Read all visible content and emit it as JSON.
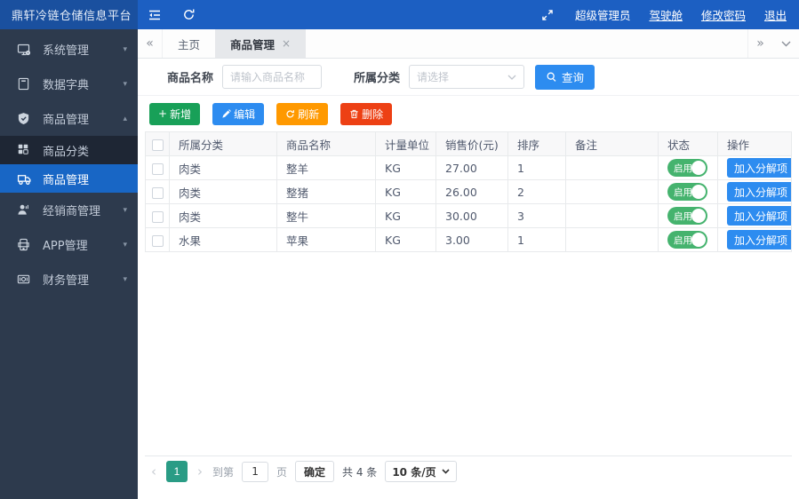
{
  "colors": {
    "topbar_blue": "#1c5fc2",
    "brand_blue": "#1a509f",
    "sidebar_bg": "#2d3a4d",
    "submenu_bg": "#1e2634",
    "active_menu_blue": "#1866c5",
    "primary_blue": "#2d8cf0",
    "success_green": "#18a058",
    "warning_orange": "#ff9900",
    "danger_red": "#ed4014",
    "switch_green": "#45b36e",
    "page_active_teal": "#2a9c85"
  },
  "glyphs": {
    "caret_down": "▾",
    "caret_up": "▴",
    "scroll_left": "«",
    "scroll_right": "»",
    "prev": "‹",
    "next": "›",
    "close": "×",
    "plus": "+"
  },
  "topbar": {
    "brand": "鼎轩冷链仓储信息平台",
    "user": "超级管理员",
    "links": [
      {
        "label": "驾驶舱"
      },
      {
        "label": "修改密码"
      },
      {
        "label": "退出"
      }
    ]
  },
  "sidebar": {
    "items": [
      {
        "label": "系统管理"
      },
      {
        "label": "数据字典"
      },
      {
        "label": "商品管理"
      },
      {
        "label": "经销商管理"
      },
      {
        "label": "APP管理"
      },
      {
        "label": "财务管理"
      }
    ],
    "submenu": [
      {
        "label": "商品分类"
      },
      {
        "label": "商品管理"
      }
    ]
  },
  "tabs": {
    "home": "主页",
    "active": "商品管理"
  },
  "search": {
    "name_label": "商品名称",
    "name_placeholder": "请输入商品名称",
    "category_label": "所属分类",
    "category_placeholder": "请选择",
    "submit_label": "查询"
  },
  "toolbar": {
    "add": "新增",
    "edit": "编辑",
    "refresh": "刷新",
    "delete": "删除"
  },
  "table": {
    "headers": [
      "所属分类",
      "商品名称",
      "计量单位",
      "销售价(元)",
      "排序",
      "备注",
      "状态",
      "操作"
    ],
    "rows": [
      {
        "category": "肉类",
        "name": "整羊",
        "unit": "KG",
        "price": "27.00",
        "order": "1",
        "remark": "",
        "status": "启用",
        "action": "加入分解项"
      },
      {
        "category": "肉类",
        "name": "整猪",
        "unit": "KG",
        "price": "26.00",
        "order": "2",
        "remark": "",
        "status": "启用",
        "action": "加入分解项"
      },
      {
        "category": "肉类",
        "name": "整牛",
        "unit": "KG",
        "price": "30.00",
        "order": "3",
        "remark": "",
        "status": "启用",
        "action": "加入分解项"
      },
      {
        "category": "水果",
        "name": "苹果",
        "unit": "KG",
        "price": "3.00",
        "order": "1",
        "remark": "",
        "status": "启用",
        "action": "加入分解项"
      }
    ]
  },
  "pagination": {
    "active_page": "1",
    "goto_label": "到第",
    "goto_value": "1",
    "page_label": "页",
    "confirm_label": "确定",
    "total_label": "共 4 条",
    "page_size_label": "10 条/页"
  }
}
